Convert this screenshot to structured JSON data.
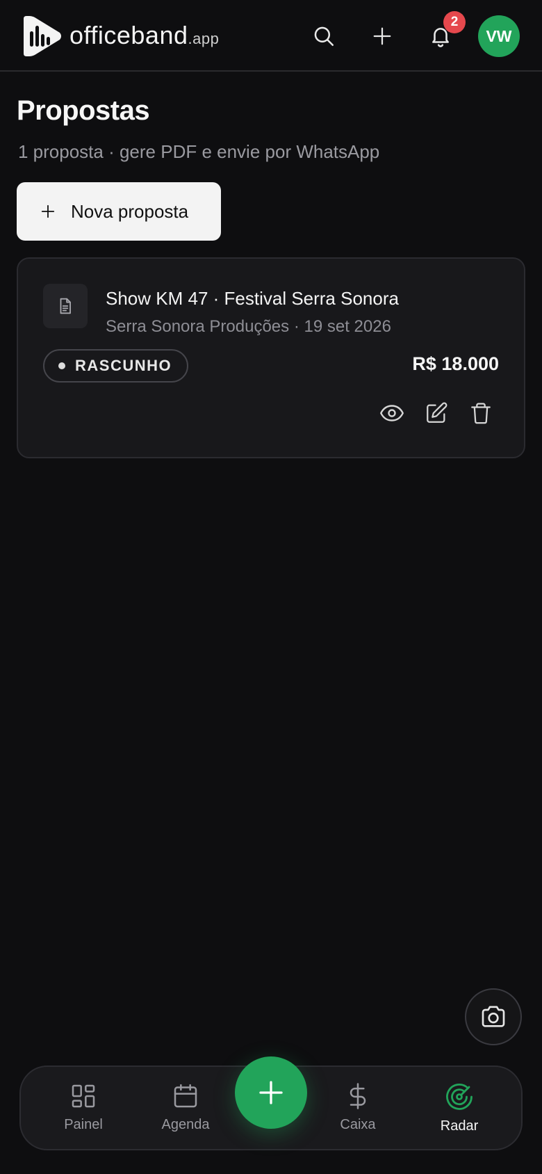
{
  "header": {
    "brand_name": "officeband",
    "brand_tld": ".app",
    "notification_count": "2",
    "avatar_initials": "VW",
    "icons": [
      "search-icon",
      "plus-icon",
      "bell-icon"
    ]
  },
  "page": {
    "title": "Propostas",
    "subtitle": "1 proposta · gere PDF e envie por WhatsApp",
    "new_button_label": "Nova proposta"
  },
  "proposals": [
    {
      "title": "Show KM 47 · Festival Serra Sonora",
      "meta": "Serra Sonora Produções · 19 set 2026",
      "status": "RASCUNHO",
      "amount": "R$ 18.000",
      "actions": [
        "eye-icon",
        "edit-icon",
        "trash-icon"
      ]
    }
  ],
  "nav": {
    "items": [
      {
        "label": "Painel",
        "icon": "grid-icon",
        "active": false
      },
      {
        "label": "Agenda",
        "icon": "calendar-icon",
        "active": false
      },
      {
        "label": "Caixa",
        "icon": "dollar-icon",
        "active": false
      },
      {
        "label": "Radar",
        "icon": "radar-icon",
        "active": true
      }
    ]
  },
  "colors": {
    "background": "#0e0e10",
    "accent_green": "#22a45a",
    "badge_red": "#e5484d",
    "card_bg": "#18181b"
  }
}
